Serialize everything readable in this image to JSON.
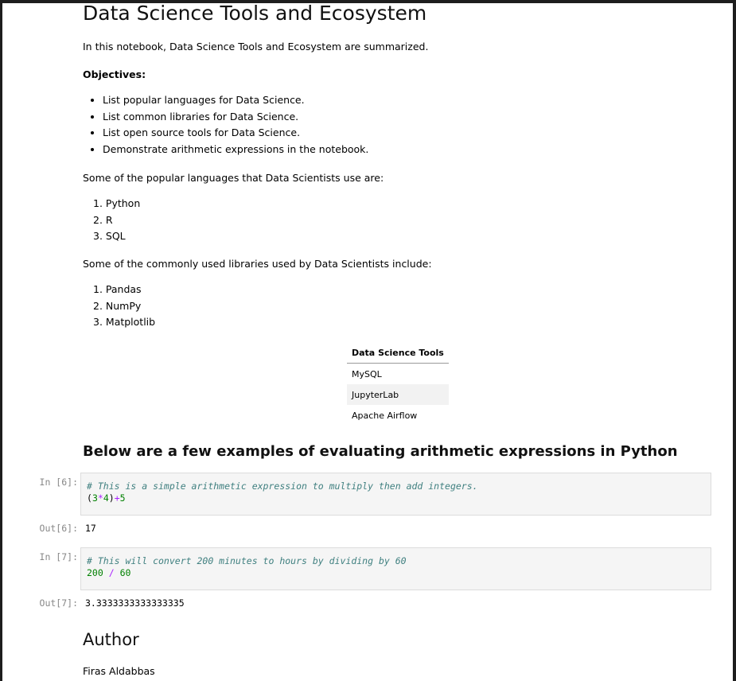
{
  "title": "Data Science Tools and Ecosystem",
  "intro": "In this notebook, Data Science Tools and Ecosystem are summarized.",
  "objectives": {
    "heading": "Objectives:",
    "items": [
      "List popular languages for Data Science.",
      "List common libraries for Data Science.",
      "List open source tools for Data Science.",
      "Demonstrate arithmetic expressions in the notebook."
    ]
  },
  "languages": {
    "intro": "Some of the popular languages that Data Scientists use are:",
    "items": [
      "Python",
      "R",
      "SQL"
    ]
  },
  "libraries": {
    "intro": "Some of the commonly used libraries used by Data Scientists include:",
    "items": [
      "Pandas",
      "NumPy",
      "Matplotlib"
    ]
  },
  "tools_table": {
    "header": "Data Science Tools",
    "rows": [
      "MySQL",
      "JupyterLab",
      "Apache Airflow"
    ]
  },
  "examples_heading": "Below are a few examples of evaluating arithmetic expressions in Python",
  "cells": [
    {
      "in_prompt": "In [6]:",
      "comment": "# This is a simple arithmetic expression to multiply then add integers.",
      "code_tokens": [
        "(",
        "3",
        "*",
        "4",
        ")",
        "+",
        "5"
      ],
      "out_prompt": "Out[6]:",
      "output": "17"
    },
    {
      "in_prompt": "In [7]:",
      "comment": "# This will convert 200 minutes to hours by dividing by 60",
      "code_tokens": [
        "200",
        " / ",
        "60"
      ],
      "out_prompt": "Out[7]:",
      "output": "3.3333333333333335"
    }
  ],
  "author": {
    "heading": "Author",
    "name": "Firas Aldabbas"
  }
}
